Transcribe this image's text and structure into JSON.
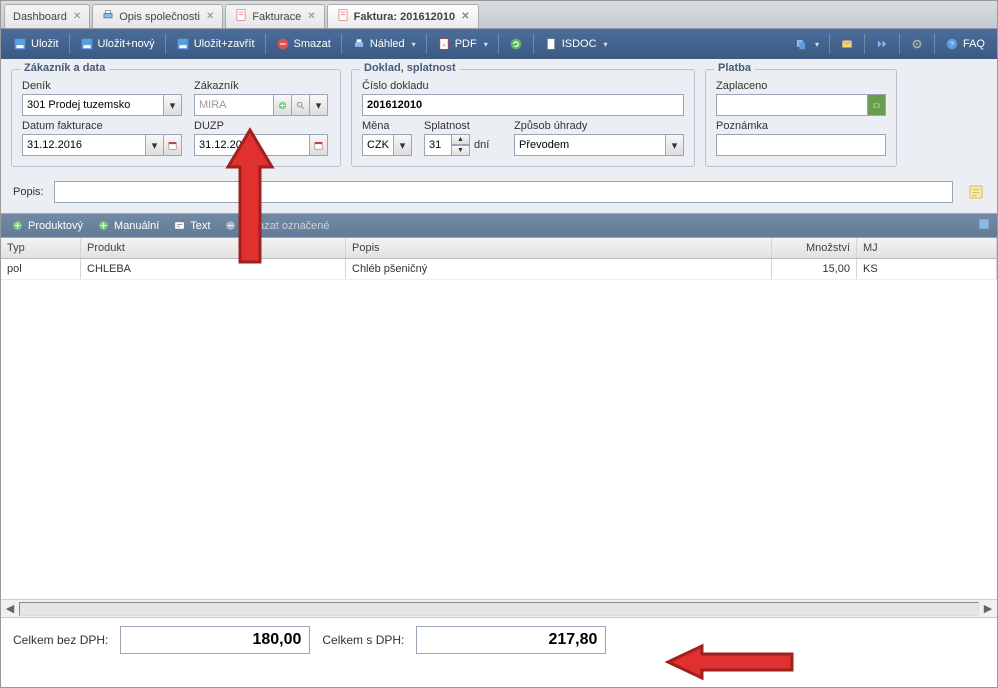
{
  "tabs": [
    {
      "label": "Dashboard",
      "closable": true,
      "active": false
    },
    {
      "label": "Opis společnosti",
      "closable": true,
      "active": false
    },
    {
      "label": "Fakturace",
      "closable": true,
      "active": false
    },
    {
      "label": "Faktura: 201612010",
      "closable": true,
      "active": true
    }
  ],
  "toolbar": {
    "save": "Uložit",
    "save_new": "Uložit+nový",
    "save_close": "Uložit+zavřít",
    "delete": "Smazat",
    "preview": "Náhled",
    "pdf": "PDF",
    "isdoc": "ISDOC",
    "faq": "FAQ"
  },
  "form": {
    "customer_data_legend": "Zákazník a data",
    "denik_label": "Deník",
    "denik_value": "301 Prodej tuzemsko",
    "zakaznik_label": "Zákazník",
    "zakaznik_value": "MIRA",
    "datum_label": "Datum fakturace",
    "datum_value": "31.12.2016",
    "duzp_label": "DUZP",
    "duzp_value": "31.12.2016",
    "doklad_legend": "Doklad, splatnost",
    "cislo_label": "Číslo dokladu",
    "cislo_value": "201612010",
    "mena_label": "Měna",
    "mena_value": "CZK",
    "splatnost_label": "Splatnost",
    "splatnost_value": "31",
    "splatnost_unit": "dní",
    "zpusob_label": "Způsob úhrady",
    "zpusob_value": "Převodem",
    "platba_legend": "Platba",
    "zaplaceno_label": "Zaplaceno",
    "zaplaceno_value": "",
    "poznamka_label": "Poznámka",
    "poznamka_value": ""
  },
  "popis": {
    "label": "Popis:",
    "value": ""
  },
  "grid_toolbar": {
    "produktovy": "Produktový",
    "manualni": "Manuální",
    "text": "Text",
    "smazat": "Smazat označené"
  },
  "grid": {
    "headers": {
      "typ": "Typ",
      "produkt": "Produkt",
      "popis": "Popis",
      "mnozstvi": "Množství",
      "mj": "MJ"
    },
    "rows": [
      {
        "typ": "pol",
        "produkt": "CHLEBA",
        "popis": "Chléb pšeničný",
        "mnozstvi": "15,00",
        "mj": "KS"
      }
    ]
  },
  "totals": {
    "bez_label": "Celkem bez DPH:",
    "bez_value": "180,00",
    "s_label": "Celkem s DPH:",
    "s_value": "217,80"
  }
}
